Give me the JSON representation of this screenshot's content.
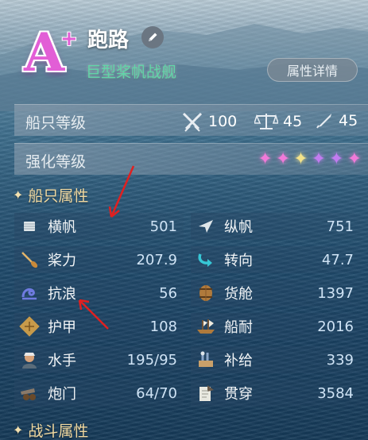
{
  "header": {
    "grade": "A",
    "grade_plus": "+",
    "ship_name": "跑路",
    "ship_type": "巨型桨帆战舰",
    "detail_button": "属性详情"
  },
  "ship_level": {
    "label": "船只等级",
    "attack": "100",
    "balance": "45",
    "repair": "45"
  },
  "enhance_level": {
    "label": "强化等级",
    "stars": [
      {
        "symbol": "✦",
        "color": "#f07ad8"
      },
      {
        "symbol": "✦",
        "color": "#f07ad8"
      },
      {
        "symbol": "✦",
        "color": "#f4e38a"
      },
      {
        "symbol": "✦",
        "color": "#c27cf0"
      },
      {
        "symbol": "✦",
        "color": "#c27cf0"
      },
      {
        "symbol": "✦",
        "color": "#f07ad8"
      }
    ]
  },
  "sections": {
    "ship_attrs": "船只属性",
    "combat_attrs": "战斗属性",
    "marker": "✦"
  },
  "stats": [
    {
      "name": "横帆",
      "value": "501",
      "icon": "square-sail-icon"
    },
    {
      "name": "纵帆",
      "value": "751",
      "icon": "lateen-sail-icon"
    },
    {
      "name": "桨力",
      "value": "207.9",
      "icon": "oar-icon"
    },
    {
      "name": "转向",
      "value": "47.7",
      "icon": "turn-arrow-icon"
    },
    {
      "name": "抗浪",
      "value": "56",
      "icon": "wave-icon"
    },
    {
      "name": "货舱",
      "value": "1397",
      "icon": "barrel-icon"
    },
    {
      "name": "护甲",
      "value": "108",
      "icon": "armor-icon"
    },
    {
      "name": "船耐",
      "value": "2016",
      "icon": "ship-durability-icon"
    },
    {
      "name": "水手",
      "value": "195/95",
      "icon": "sailor-icon"
    },
    {
      "name": "补给",
      "value": "339",
      "icon": "supply-icon"
    },
    {
      "name": "炮门",
      "value": "64/70",
      "icon": "cannon-icon"
    },
    {
      "name": "贯穿",
      "value": "3584",
      "icon": "penetration-icon"
    }
  ],
  "colors": {
    "grade": "#e25ed6",
    "ship_type": "#62d4a8",
    "section": "#f1d9a0",
    "annotation_arrow": "#e02020"
  }
}
